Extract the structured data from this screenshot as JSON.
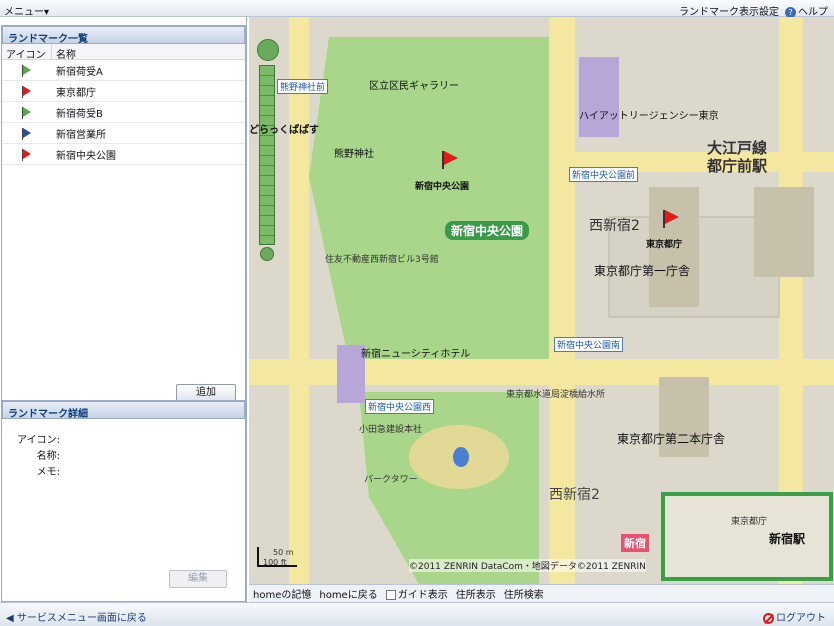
{
  "topbar": {
    "menu_label": "メニュー▾",
    "landmark_display_settings": "ランドマーク表示設定",
    "help_label": "ヘルプ"
  },
  "landmark_list": {
    "title": "ランドマーク一覧",
    "columns": [
      "アイコン",
      "名称"
    ],
    "rows": [
      {
        "name": "新宿荷受A",
        "flag_color": "#5aa84a"
      },
      {
        "name": "東京都庁",
        "flag_color": "#e31a1a"
      },
      {
        "name": "新宿荷受B",
        "flag_color": "#5aa84a"
      },
      {
        "name": "新宿営業所",
        "flag_color": "#2b4aa0"
      },
      {
        "name": "新宿中央公園",
        "flag_color": "#e31a1a"
      }
    ],
    "add_button": "追加"
  },
  "landmark_detail": {
    "title": "ランドマーク詳細",
    "icon_label": "アイコン:",
    "name_label": "名称:",
    "memo_label": "メモ:",
    "edit_button": "編集"
  },
  "map": {
    "labels": {
      "park_name": "新宿中央公園",
      "park_flag": "新宿中央公園",
      "tocho_flag": "東京都庁",
      "nishi_shinjuku_2_a": "西新宿2",
      "nishi_shinjuku_2_b": "西新宿2",
      "tocho_first": "東京都庁第一庁舎",
      "tocho_second": "東京都庁第二本庁舎",
      "oedo_line": "大江戸線",
      "tochomae_station": "都庁前駅",
      "shinjuku_small": "新宿",
      "hyatt": "ハイアットリージェンシー東京",
      "kumano": "熊野神社",
      "new_city_hotel": "新宿ニューシティホテル",
      "doraku": "どらっくぱぱす",
      "sumitomo": "住友不動産西新宿ビル3号館",
      "gallery": "区立区民ギャラリー",
      "odakyu": "小田急建設本社",
      "water_bureau": "東京都水道局淀橋給水所",
      "park_tower": "パークタワー"
    },
    "station_tags": [
      "新宿中央公園前",
      "新宿中央公園南",
      "新宿中央公園西",
      "熊野神社前"
    ],
    "scale_m": "50 m",
    "scale_ft": "100 ft",
    "copyright": "©2011 ZENRIN DataCom・地図データ©2011 ZENRIN",
    "overview": {
      "tocho": "東京都庁",
      "station": "新宿駅"
    }
  },
  "map_toolbar": {
    "home_memory": "homeの記憶",
    "home_return": "homeに戻る",
    "guide_display": "ガイド表示",
    "address_display": "住所表示",
    "address_search": "住所検索"
  },
  "footer": {
    "back_label": "サービスメニュー画面に戻る",
    "logout_label": "ログアウト"
  }
}
